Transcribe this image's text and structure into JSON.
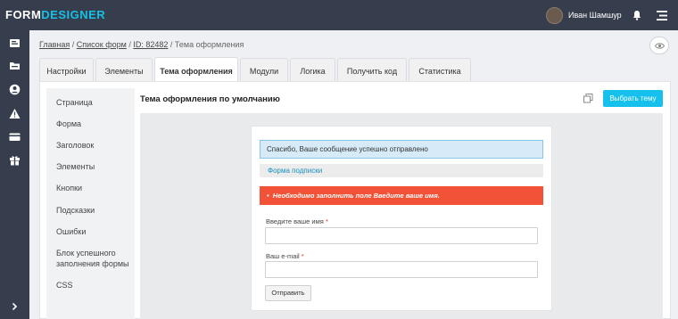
{
  "app": {
    "logo_main": "FORM",
    "logo_accent": "DESIGNER"
  },
  "user": {
    "name": "Иван Шамшур"
  },
  "icons": {
    "top": [
      "bell-icon",
      "hamburger-menu-icon"
    ],
    "sidebar": [
      "document-icon",
      "folder-icon",
      "user-circle-icon",
      "warning-icon",
      "credit-card-icon",
      "gift-icon",
      "chevron-right-icon"
    ],
    "view": "eye-icon",
    "copy": "copy-icon"
  },
  "breadcrumb": {
    "items": [
      "Главная",
      "Список форм",
      "ID: 82482"
    ],
    "separator": " / ",
    "current": "Тема оформления"
  },
  "tabs": [
    {
      "label": "Настройки"
    },
    {
      "label": "Элементы"
    },
    {
      "label": "Тема оформления"
    },
    {
      "label": "Модули"
    },
    {
      "label": "Логика"
    },
    {
      "label": "Получить код"
    },
    {
      "label": "Статистика"
    }
  ],
  "active_tab": "Тема оформления",
  "left_nav": [
    {
      "label": "Страница"
    },
    {
      "label": "Форма"
    },
    {
      "label": "Заголовок"
    },
    {
      "label": "Элементы"
    },
    {
      "label": "Кнопки"
    },
    {
      "label": "Подсказки"
    },
    {
      "label": "Ошибки"
    },
    {
      "label": "Блок успешного заполнения формы"
    },
    {
      "label": "CSS"
    }
  ],
  "content": {
    "title": "Тема оформления по умолчанию",
    "choose_theme_label": "Выбрать тему"
  },
  "preview_form": {
    "success_message": "Спасибо, Ваше сообщение успешно отправлено",
    "form_title": "Форма подписки",
    "error_message": "Необходимо заполнить поле Введите ваше имя.",
    "fields": [
      {
        "label": "Введите ваше имя",
        "required_mark": "*",
        "value": ""
      },
      {
        "label": "Ваш e-mail",
        "required_mark": "*",
        "value": ""
      }
    ],
    "submit_label": "Отправить"
  },
  "colors": {
    "topbar": "#363d4d",
    "accent": "#16c0ec",
    "error": "#f25237",
    "success_bg": "#d6eaf8",
    "link": "#1a8fc0"
  }
}
